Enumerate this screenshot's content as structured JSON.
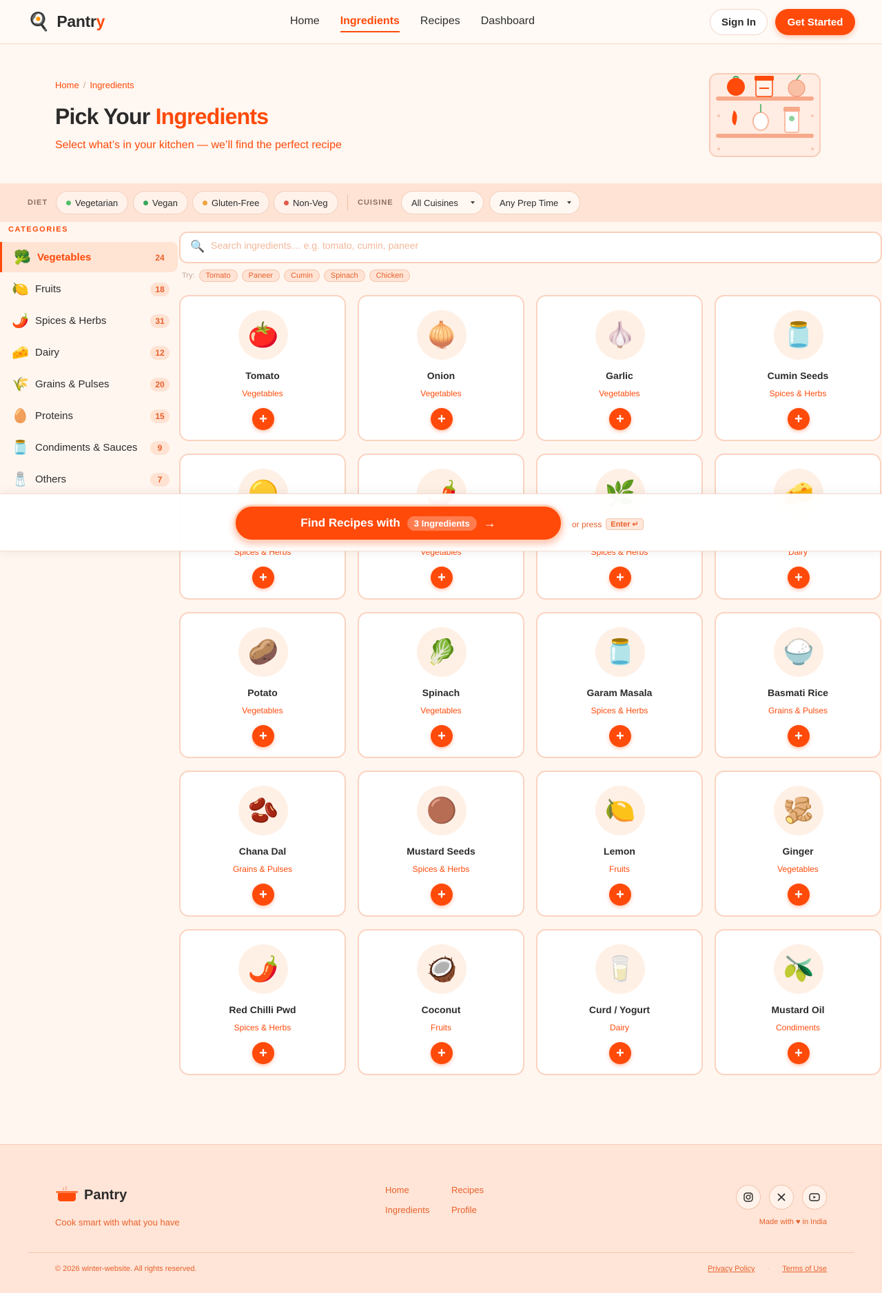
{
  "brand": {
    "name_main": "Pantr",
    "name_accent": "y",
    "logo_icon": "frying-pan-icon",
    "footer_name": "Pantry"
  },
  "nav": {
    "links": [
      {
        "label": "Home",
        "active": false
      },
      {
        "label": "Ingredients",
        "active": true
      },
      {
        "label": "Recipes",
        "active": false
      },
      {
        "label": "Dashboard",
        "active": false
      }
    ],
    "sign_in": "Sign In",
    "get_started": "Get Started"
  },
  "hero": {
    "breadcrumb": [
      "Home",
      "Ingredients"
    ],
    "title_main": "Pick Your ",
    "title_accent": "Ingredients",
    "subtitle": "Select what’s in your kitchen — we’ll find the perfect recipe"
  },
  "filters": {
    "diet_label": "DIET",
    "diet": [
      {
        "label": "Vegetarian",
        "color": "#4fbf6a"
      },
      {
        "label": "Vegan",
        "color": "#3aa85a"
      },
      {
        "label": "Gluten-Free",
        "color": "#f0a33a"
      },
      {
        "label": "Non-Veg",
        "color": "#e0584a"
      }
    ],
    "cuisine_label": "CUISINE",
    "cuisine_value": "All Cuisines",
    "prep_value": "Any Prep Time"
  },
  "sidebar": {
    "title": "CATEGORIES",
    "items": [
      {
        "label": "Vegetables",
        "count": "24",
        "icon": "broccoli-icon",
        "glyph": "🥦",
        "active": true
      },
      {
        "label": "Fruits",
        "count": "18",
        "icon": "lemon-icon",
        "glyph": "🍋",
        "active": false
      },
      {
        "label": "Spices & Herbs",
        "count": "31",
        "icon": "chili-icon",
        "glyph": "🌶️",
        "active": false
      },
      {
        "label": "Dairy",
        "count": "12",
        "icon": "cheese-icon",
        "glyph": "🧀",
        "active": false
      },
      {
        "label": "Grains & Pulses",
        "count": "20",
        "icon": "wheat-icon",
        "glyph": "🌾",
        "active": false
      },
      {
        "label": "Proteins",
        "count": "15",
        "icon": "egg-icon",
        "glyph": "🥚",
        "active": false
      },
      {
        "label": "Condiments & Sauces",
        "count": "9",
        "icon": "jar-icon",
        "glyph": "🫙",
        "active": false
      },
      {
        "label": "Others",
        "count": "7",
        "icon": "salt-icon",
        "glyph": "🧂",
        "active": false
      }
    ]
  },
  "search": {
    "placeholder": "Search ingredients… e.g. tomato, cumin, paneer",
    "try_label": "Try:",
    "suggestions": [
      "Tomato",
      "Paneer",
      "Cumin",
      "Spinach",
      "Chicken"
    ]
  },
  "ingredients": [
    {
      "name": "Tomato",
      "category": "Vegetables",
      "glyph": "🍅",
      "icon": "tomato-icon"
    },
    {
      "name": "Onion",
      "category": "Vegetables",
      "glyph": "🧅",
      "icon": "onion-icon"
    },
    {
      "name": "Garlic",
      "category": "Vegetables",
      "glyph": "🧄",
      "icon": "garlic-icon"
    },
    {
      "name": "Cumin Seeds",
      "category": "Spices & Herbs",
      "glyph": "🫙",
      "icon": "jar-icon"
    },
    {
      "name": "",
      "category": "Spices & Herbs",
      "glyph": "🟡",
      "icon": "turmeric-icon"
    },
    {
      "name": "",
      "category": "Vegetables",
      "glyph": "🌶️",
      "icon": "chili-icon"
    },
    {
      "name": "",
      "category": "Spices & Herbs",
      "glyph": "🌿",
      "icon": "herb-icon"
    },
    {
      "name": "",
      "category": "Dairy",
      "glyph": "🧀",
      "icon": "cheese-icon"
    },
    {
      "name": "Potato",
      "category": "Vegetables",
      "glyph": "🥔",
      "icon": "potato-icon"
    },
    {
      "name": "Spinach",
      "category": "Vegetables",
      "glyph": "🥬",
      "icon": "spinach-icon"
    },
    {
      "name": "Garam Masala",
      "category": "Spices & Herbs",
      "glyph": "🫙",
      "icon": "jar-icon"
    },
    {
      "name": "Basmati Rice",
      "category": "Grains & Pulses",
      "glyph": "🍚",
      "icon": "rice-icon"
    },
    {
      "name": "Chana Dal",
      "category": "Grains & Pulses",
      "glyph": "🫘",
      "icon": "beans-icon"
    },
    {
      "name": "Mustard Seeds",
      "category": "Spices & Herbs",
      "glyph": "🟤",
      "icon": "seeds-icon"
    },
    {
      "name": "Lemon",
      "category": "Fruits",
      "glyph": "🍋",
      "icon": "lemon-icon"
    },
    {
      "name": "Ginger",
      "category": "Vegetables",
      "glyph": "🫚",
      "icon": "ginger-icon"
    },
    {
      "name": "Red Chilli Pwd",
      "category": "Spices & Herbs",
      "glyph": "🌶️",
      "icon": "chili-icon"
    },
    {
      "name": "Coconut",
      "category": "Fruits",
      "glyph": "🥥",
      "icon": "coconut-icon"
    },
    {
      "name": "Curd / Yogurt",
      "category": "Dairy",
      "glyph": "🥛",
      "icon": "yogurt-icon"
    },
    {
      "name": "Mustard Oil",
      "category": "Condiments",
      "glyph": "🫒",
      "icon": "oil-icon"
    }
  ],
  "cta": {
    "label": "Find Recipes with",
    "badge": "3 Ingredients",
    "or_press": "or press",
    "key": "Enter ↵"
  },
  "footer": {
    "tagline": "Cook smart with what you have",
    "links": [
      "Home",
      "Recipes",
      "Ingredients",
      "Profile"
    ],
    "social": [
      {
        "icon": "instagram-icon",
        "glyph": "◎"
      },
      {
        "icon": "x-icon",
        "glyph": "✕"
      },
      {
        "icon": "youtube-icon",
        "glyph": "▶"
      }
    ],
    "made_with": "Made with ♥ in India",
    "copyright": "© 2026 winter-website. All rights reserved.",
    "privacy": "Privacy Policy",
    "terms": "Terms of Use"
  },
  "colors": {
    "accent": "#ff4a0a",
    "accent_soft": "#ffe4d5",
    "background": "#fff6f0"
  }
}
